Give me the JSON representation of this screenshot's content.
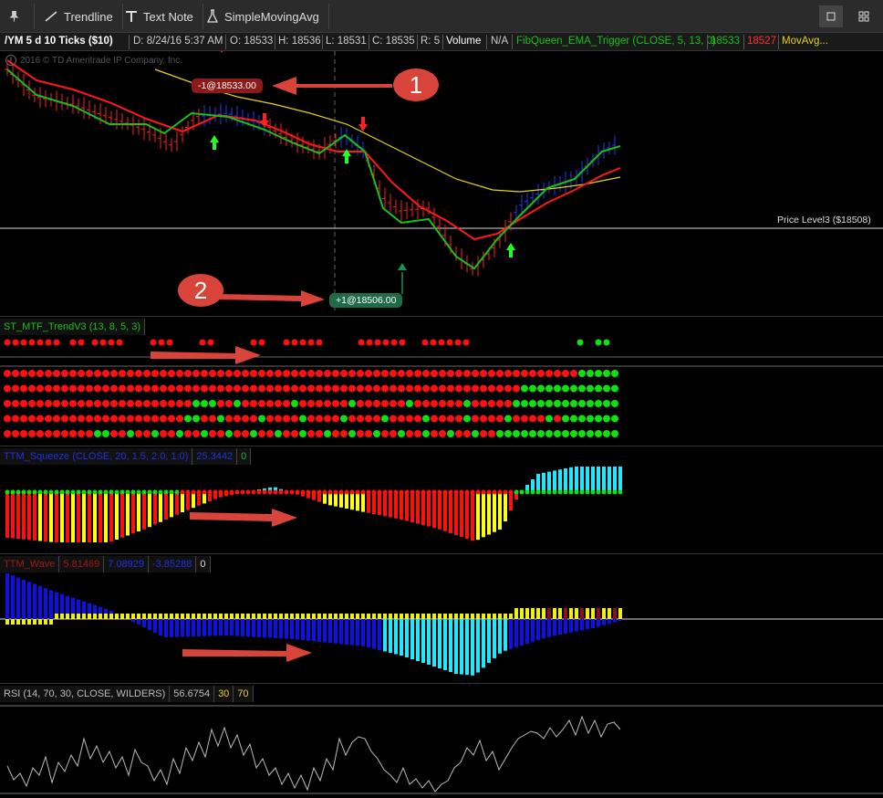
{
  "toolbar": {
    "pin_label": "",
    "trendline_label": "Trendline",
    "textnote_label": "Text Note",
    "sma_label": "SimpleMovingAvg"
  },
  "header": {
    "symbol": "/YM 5 d 10 Ticks ($10)",
    "date": "D: 8/24/16 5:37 AM",
    "open": "O: 18533",
    "high": "H: 18536",
    "low": "L: 18531",
    "close": "C: 18535",
    "range": "R: 5",
    "volume": "Volume",
    "na": "N/A",
    "study": "FibQueen_EMA_Trigger (CLOSE, 5, 13, 0)",
    "v1": "18533",
    "v2": "18527",
    "movavg": "MovAvg..."
  },
  "price_chart": {
    "copyright": "2016 © TD Ameritrade IP Company, Inc.",
    "sell_tag": "-1@18533.00",
    "buy_tag": "+1@18506.00",
    "price_level": "Price Level3 ($18508)",
    "annotation_1": "1",
    "annotation_2": "2"
  },
  "trend_panel": {
    "label": "ST_MTF_TrendV3 (13, 8, 5, 3)"
  },
  "squeeze_panel": {
    "label": "TTM_Squeeze (CLOSE, 20, 1.5, 2.0, 1.0)",
    "value": "25.3442",
    "flag": "0"
  },
  "wave_panel": {
    "label": "TTM_Wave",
    "v1": "5.81469",
    "v2": "7.08929",
    "v3": "-3.85288",
    "v4": "0"
  },
  "rsi_panel": {
    "label": "RSI (14, 70, 30, CLOSE, WILDERS)",
    "value": "56.6754",
    "low": "30",
    "high": "70"
  },
  "colors": {
    "up_bar": "#1a3cff",
    "down_bar": "#ff2020",
    "ema_fast": "#18c018",
    "ema_slow": "#ff1818",
    "movavg": "#e6d21a",
    "dot_red": "#ff1010",
    "dot_green": "#10e010",
    "squeeze_red": "#ff1010",
    "squeeze_yellow": "#ffff10",
    "squeeze_cyan": "#20e8ff",
    "wave_blue": "#1010e0",
    "wave_yellow": "#f0f010",
    "wave_cyan": "#20e8ff",
    "annotation": "#d9443a"
  }
}
